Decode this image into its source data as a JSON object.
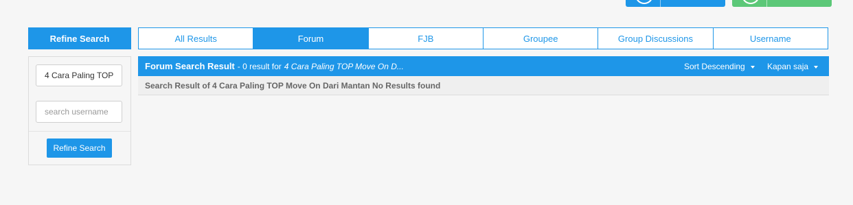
{
  "colors": {
    "accent": "#1e96e8",
    "success": "#5cc878",
    "background": "#f6f6f6"
  },
  "header": {
    "buttons": [
      {
        "icon": "user-icon"
      },
      {
        "icon": "user-icon"
      }
    ]
  },
  "sidebar": {
    "heading": "Refine Search",
    "keyword_value": "4 Cara Paling TOP",
    "username_placeholder": "search username",
    "submit_label": "Refine Search"
  },
  "tabs": [
    {
      "label": "All Results",
      "active": false
    },
    {
      "label": "Forum",
      "active": true
    },
    {
      "label": "FJB",
      "active": false
    },
    {
      "label": "Groupee",
      "active": false
    },
    {
      "label": "Group Discussions",
      "active": false
    },
    {
      "label": "Username",
      "active": false
    }
  ],
  "results": {
    "title": "Forum Search Result",
    "count_text": "- 0 result for",
    "query_text": "4 Cara Paling TOP Move On D...",
    "sort_label": "Sort Descending",
    "time_label": "Kapan saja",
    "message": "Search Result of 4 Cara Paling TOP Move On Dari Mantan No Results found"
  }
}
